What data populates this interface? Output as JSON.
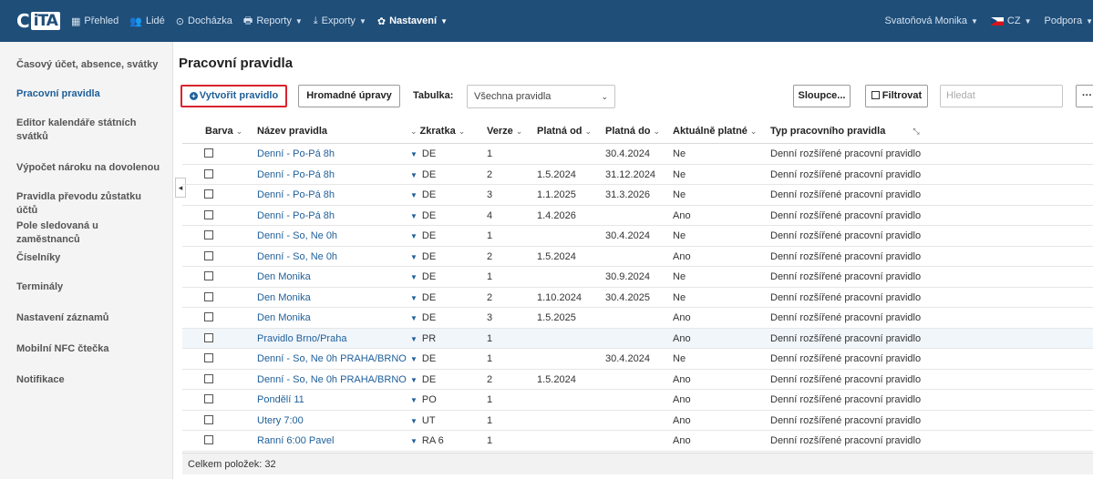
{
  "topbar": {
    "logo_prefix": "C",
    "logo_box": "iTA",
    "nav": [
      {
        "label": "Přehled",
        "icon": "grid-icon",
        "glyph": "▦",
        "caret": false,
        "active": false
      },
      {
        "label": "Lidé",
        "icon": "people-icon",
        "glyph": "👥",
        "caret": false,
        "active": false
      },
      {
        "label": "Docházka",
        "icon": "clock-icon",
        "glyph": "⊙",
        "caret": false,
        "active": false
      },
      {
        "label": "Reporty",
        "icon": "printer-icon",
        "glyph": "🖶",
        "caret": true,
        "active": false
      },
      {
        "label": "Exporty",
        "icon": "export-icon",
        "glyph": "⤓",
        "caret": true,
        "active": false
      },
      {
        "label": "Nastavení",
        "icon": "gear-icon",
        "glyph": "✿",
        "caret": true,
        "active": true
      }
    ],
    "user": "Svatoňová Monika",
    "language": "CZ",
    "support": "Podpora"
  },
  "sidebar": {
    "items": [
      {
        "label": "Časový účet, absence, svátky",
        "active": false
      },
      {
        "label": "Pracovní pravidla",
        "active": true
      },
      {
        "label": "Editor kalendáře státních svátků",
        "active": false
      },
      {
        "label": "Výpočet nároku na dovolenou",
        "active": false
      },
      {
        "label": "Pravidla převodu zůstatku účtů",
        "active": false
      },
      {
        "label": "Pole sledovaná u zaměstnanců",
        "active": false
      },
      {
        "label": "Číselníky",
        "active": false
      },
      {
        "label": "Terminály",
        "active": false
      },
      {
        "label": "Nastavení záznamů",
        "active": false
      },
      {
        "label": "Mobilní NFC čtečka",
        "active": false
      },
      {
        "label": "Notifikace",
        "active": false
      }
    ],
    "collapse_glyph": "◂"
  },
  "main": {
    "title": "Pracovní pravidla",
    "create_label": "Vytvořit pravidlo",
    "mass_label": "Hromadné úpravy",
    "table_label": "Tabulka:",
    "table_select": "Všechna pravidla",
    "columns_label": "Sloupce...",
    "filter_label": "Filtrovat",
    "search_placeholder": "Hledat",
    "more_label": "···"
  },
  "table": {
    "headers": {
      "color": "Barva",
      "name": "Název pravidla",
      "code": "Zkratka",
      "version": "Verze",
      "from": "Platná od",
      "to": "Platná do",
      "current": "Aktuálně platné",
      "type": "Typ pracovního pravidla"
    },
    "rows": [
      {
        "name": "Denní - Po-Pá 8h",
        "code": "DE",
        "version": "1",
        "from": "",
        "to": "30.4.2024",
        "current": "Ne",
        "type": "Denní rozšířené pracovní pravidlo",
        "hl": false
      },
      {
        "name": "Denní - Po-Pá 8h",
        "code": "DE",
        "version": "2",
        "from": "1.5.2024",
        "to": "31.12.2024",
        "current": "Ne",
        "type": "Denní rozšířené pracovní pravidlo",
        "hl": false
      },
      {
        "name": "Denní - Po-Pá 8h",
        "code": "DE",
        "version": "3",
        "from": "1.1.2025",
        "to": "31.3.2026",
        "current": "Ne",
        "type": "Denní rozšířené pracovní pravidlo",
        "hl": false
      },
      {
        "name": "Denní - Po-Pá 8h",
        "code": "DE",
        "version": "4",
        "from": "1.4.2026",
        "to": "",
        "current": "Ano",
        "type": "Denní rozšířené pracovní pravidlo",
        "hl": false
      },
      {
        "name": "Denní - So, Ne 0h",
        "code": "DE",
        "version": "1",
        "from": "",
        "to": "30.4.2024",
        "current": "Ne",
        "type": "Denní rozšířené pracovní pravidlo",
        "hl": false
      },
      {
        "name": "Denní - So, Ne 0h",
        "code": "DE",
        "version": "2",
        "from": "1.5.2024",
        "to": "",
        "current": "Ano",
        "type": "Denní rozšířené pracovní pravidlo",
        "hl": false
      },
      {
        "name": "Den Monika",
        "code": "DE",
        "version": "1",
        "from": "",
        "to": "30.9.2024",
        "current": "Ne",
        "type": "Denní rozšířené pracovní pravidlo",
        "hl": false
      },
      {
        "name": "Den Monika",
        "code": "DE",
        "version": "2",
        "from": "1.10.2024",
        "to": "30.4.2025",
        "current": "Ne",
        "type": "Denní rozšířené pracovní pravidlo",
        "hl": false
      },
      {
        "name": "Den Monika",
        "code": "DE",
        "version": "3",
        "from": "1.5.2025",
        "to": "",
        "current": "Ano",
        "type": "Denní rozšířené pracovní pravidlo",
        "hl": false
      },
      {
        "name": "Pravidlo Brno/Praha",
        "code": "PR",
        "version": "1",
        "from": "",
        "to": "",
        "current": "Ano",
        "type": "Denní rozšířené pracovní pravidlo",
        "hl": true
      },
      {
        "name": "Denní - So, Ne 0h PRAHA/BRNO",
        "code": "DE",
        "version": "1",
        "from": "",
        "to": "30.4.2024",
        "current": "Ne",
        "type": "Denní rozšířené pracovní pravidlo",
        "hl": false
      },
      {
        "name": "Denní - So, Ne 0h PRAHA/BRNO",
        "code": "DE",
        "version": "2",
        "from": "1.5.2024",
        "to": "",
        "current": "Ano",
        "type": "Denní rozšířené pracovní pravidlo",
        "hl": false
      },
      {
        "name": "Pondělí 11",
        "code": "PO",
        "version": "1",
        "from": "",
        "to": "",
        "current": "Ano",
        "type": "Denní rozšířené pracovní pravidlo",
        "hl": false
      },
      {
        "name": "Utery 7:00",
        "code": "UT",
        "version": "1",
        "from": "",
        "to": "",
        "current": "Ano",
        "type": "Denní rozšířené pracovní pravidlo",
        "hl": false
      },
      {
        "name": "Ranní 6:00 Pavel",
        "code": "RA 6",
        "version": "1",
        "from": "",
        "to": "",
        "current": "Ano",
        "type": "Denní rozšířené pracovní pravidlo",
        "hl": false
      }
    ],
    "footer": "Celkem položek: 32"
  },
  "colors": {
    "topbar": "#1f4e79",
    "link": "#1f5f99",
    "highlight_border": "#d9232f",
    "row_highlight": "#f1f6fb"
  }
}
